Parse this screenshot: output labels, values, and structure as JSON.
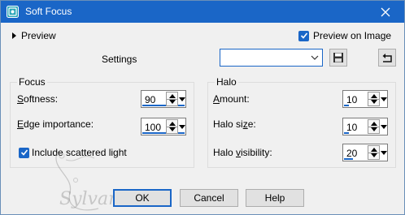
{
  "window": {
    "title": "Soft Focus"
  },
  "preview": {
    "label": "Preview",
    "on_image_label": "Preview on Image",
    "on_image_checked": true
  },
  "settings": {
    "label": "Settings",
    "combo_value": ""
  },
  "focus": {
    "title": "Focus",
    "softness_label": "Softness:",
    "softness_value": "90",
    "softness_fill": 0.9,
    "edge_label": "Edge importance:",
    "edge_value": "100",
    "edge_fill": 1.0,
    "scatter_label": "Include scattered light",
    "scatter_checked": true
  },
  "halo": {
    "title": "Halo",
    "amount_label": "Amount:",
    "amount_value": "10",
    "amount_fill": 0.1,
    "size_label": "Halo size:",
    "size_value": "10",
    "size_fill": 0.1,
    "visibility_label": "Halo visibility:",
    "visibility_value": "20",
    "visibility_fill": 0.2
  },
  "buttons": {
    "ok": "OK",
    "cancel": "Cancel",
    "help": "Help"
  },
  "watermark": "Sylvane",
  "colors": {
    "accent": "#1a66c7",
    "face": "#f0f0f0"
  }
}
